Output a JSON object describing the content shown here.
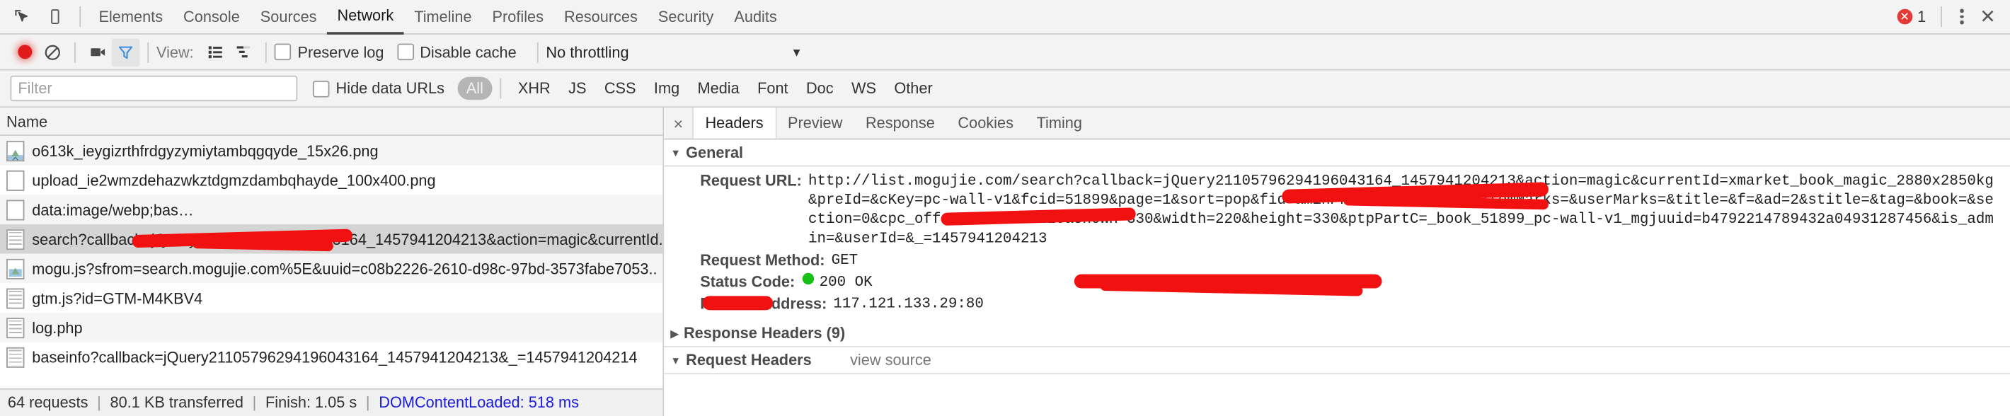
{
  "devtools": {
    "panel_tabs": [
      {
        "label": "Elements",
        "active": false
      },
      {
        "label": "Console",
        "active": false
      },
      {
        "label": "Sources",
        "active": false
      },
      {
        "label": "Network",
        "active": true
      },
      {
        "label": "Timeline",
        "active": false
      },
      {
        "label": "Profiles",
        "active": false
      },
      {
        "label": "Resources",
        "active": false
      },
      {
        "label": "Security",
        "active": false
      },
      {
        "label": "Audits",
        "active": false
      }
    ],
    "error_count": "1",
    "icons": {
      "inspect": "inspect-element-icon",
      "device": "device-toolbar-icon",
      "error": "error-badge-icon",
      "menu": "kebab-menu-icon",
      "close": "close-devtools-icon"
    }
  },
  "network_toolbar": {
    "record_title": "record-button",
    "clear_title": "clear-button",
    "capture_screenshots_title": "camera-button",
    "filter_title": "filter-button",
    "view_label": "View:",
    "view_list_title": "list-view-button",
    "view_waterfall_title": "waterfall-view-button",
    "preserve_log": "Preserve log",
    "preserve_log_checked": false,
    "disable_cache": "Disable cache",
    "disable_cache_checked": false,
    "throttling": "No throttling"
  },
  "filter_bar": {
    "filter_placeholder": "Filter",
    "filter_value": "",
    "hide_data_urls": "Hide data URLs",
    "hide_data_urls_checked": false,
    "types": [
      {
        "label": "All",
        "selected": true
      },
      {
        "label": "XHR",
        "selected": false
      },
      {
        "label": "JS",
        "selected": false
      },
      {
        "label": "CSS",
        "selected": false
      },
      {
        "label": "Img",
        "selected": false
      },
      {
        "label": "Media",
        "selected": false
      },
      {
        "label": "Font",
        "selected": false
      },
      {
        "label": "Doc",
        "selected": false
      },
      {
        "label": "WS",
        "selected": false
      },
      {
        "label": "Other",
        "selected": false
      }
    ]
  },
  "request_table": {
    "column_header": "Name",
    "rows": [
      {
        "name": "o613k_ieygizrthfrdgyzymiytambqgqyde_15x26.png",
        "icon": "image-file-icon",
        "selected": false
      },
      {
        "name": "upload_ie2wmzdehazwkztdgmzdambqhayde_100x400.png",
        "icon": "image-file-icon",
        "selected": false
      },
      {
        "name": "data:image/webp;bas…",
        "icon": "data-url-icon",
        "selected": false
      },
      {
        "name": "search?callback=jQuery21105796294196043164_1457941204213&action=magic&currentId.",
        "icon": "script-file-icon",
        "selected": true
      },
      {
        "name": "mogu.js?sfrom=search.mogujie.com%5E&uuid=c08b2226-2610-d98c-97bd-3573fabe7053..",
        "icon": "script-image-icon",
        "selected": false
      },
      {
        "name": "gtm.js?id=GTM-M4KBV4",
        "icon": "script-file-icon",
        "selected": false
      },
      {
        "name": "log.php",
        "icon": "script-file-icon",
        "selected": false
      },
      {
        "name": "baseinfo?callback=jQuery21105796294196043164_1457941204213&_=1457941204214",
        "icon": "script-file-icon",
        "selected": false
      }
    ]
  },
  "status_bar": {
    "requests": "64 requests",
    "transferred": "80.1 KB transferred",
    "finish": "Finish: 1.05 s",
    "dom_content_loaded": "DOMContentLoaded: 518 ms",
    "separator": "|"
  },
  "detail_pane": {
    "close_label": "×",
    "tabs": [
      {
        "label": "Headers",
        "active": true
      },
      {
        "label": "Preview",
        "active": false
      },
      {
        "label": "Response",
        "active": false
      },
      {
        "label": "Cookies",
        "active": false
      },
      {
        "label": "Timing",
        "active": false
      }
    ],
    "general": {
      "title": "General",
      "expanded": true,
      "request_url_key": "Request URL:",
      "request_url_value": "http://list.mogujie.com/search?callback=jQuery21105796294196043164_1457941204213&action=magic&currentId=xmarket_book_magic_2880x2850kg&preId=&cKey=pc-wall-v1&fcid=51899&page=1&sort=pop&fid=&minPrice=&maxPrice=&itemMarks=&userMarks=&title=&f=&ad=2&stitle=&tag=&book=&section=0&cpc_offset=&showW=220&showH=330&width=220&height=330&ptpPartC=_book_51899_pc-wall-v1_mgjuuid=b4792214789432a04931287456&is_admin=&userId=&_=1457941204213",
      "request_method_key": "Request Method:",
      "request_method_value": "GET",
      "status_code_key": "Status Code:",
      "status_code_value": "200  OK",
      "remote_address_key": "Remote Address:",
      "remote_address_value": "117.121.133.29:80"
    },
    "response_headers": {
      "title": "Response Headers (9)",
      "expanded": false
    },
    "request_headers": {
      "title": "Request Headers",
      "expanded": true,
      "view_source": "view source"
    }
  },
  "colors": {
    "toolbar_bg": "#f3f3f3",
    "selection": "#d4d4d4",
    "record_red": "#e01b1b",
    "filter_blue": "#4a90e2",
    "status_green": "#17c017",
    "link_blue": "#1a1ae0",
    "redaction_red": "#f21111",
    "error_red": "#e53935"
  }
}
